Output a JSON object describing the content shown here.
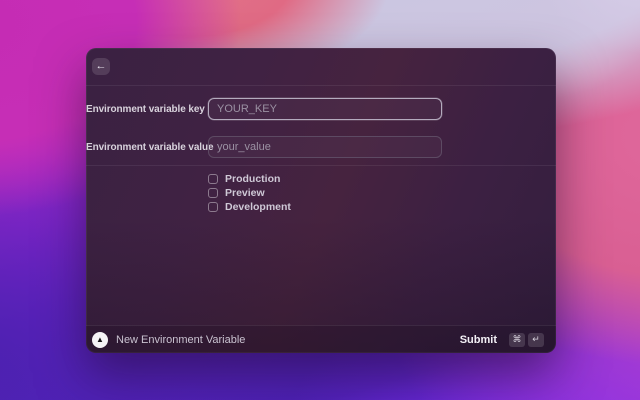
{
  "window": {
    "header": {
      "back_icon": "←"
    },
    "form": {
      "fields": [
        {
          "label": "Environment variable key",
          "placeholder": "YOUR_KEY",
          "value": "",
          "focused": true
        },
        {
          "label": "Environment variable value",
          "placeholder": "your_value",
          "value": "",
          "focused": false
        }
      ],
      "checkboxes": [
        {
          "label": "Production",
          "checked": false
        },
        {
          "label": "Preview",
          "checked": false
        },
        {
          "label": "Development",
          "checked": false
        }
      ]
    },
    "footer": {
      "app_icon_glyph": "▲",
      "title": "New Environment Variable",
      "primary_action": "Submit",
      "shortcut_keys": [
        "⌘",
        "↵"
      ]
    }
  },
  "colors": {
    "focused_input_border": "#b4abbe",
    "unfocused_input_border": "#5d4a63",
    "window_background": "#3c2141",
    "label_text": "#d8d2dc",
    "placeholder_text": "#9b91a3",
    "wallpaper_palette": [
      "#c52cb4",
      "#e2738a",
      "#c9c8e2",
      "#e0689c",
      "#7022ca",
      "#4c21b4",
      "#7d2ae8"
    ]
  }
}
